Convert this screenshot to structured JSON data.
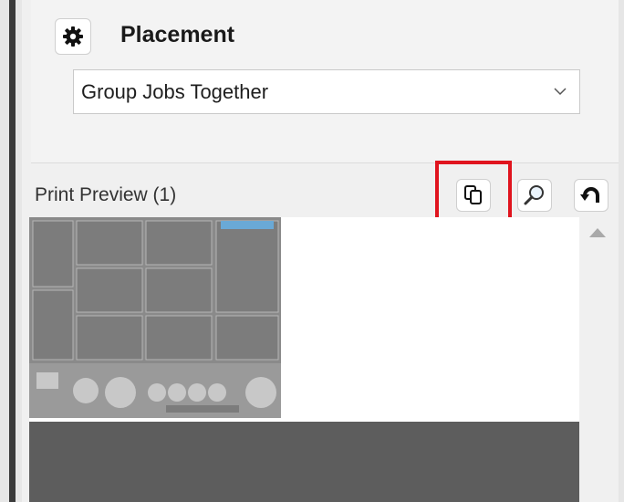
{
  "placement": {
    "title": "Placement",
    "gear_icon": "gear-icon",
    "selected_option": "Group Jobs Together"
  },
  "preview": {
    "title": "Print Preview (1)",
    "tools": {
      "copy_icon": "copy-icon",
      "zoom_icon": "magnifier-icon",
      "undo_icon": "undo-icon"
    }
  },
  "colors": {
    "highlight": "#e0141e",
    "dark_area": "#5d5d5d",
    "thumbnail": "#8e8e8e"
  }
}
